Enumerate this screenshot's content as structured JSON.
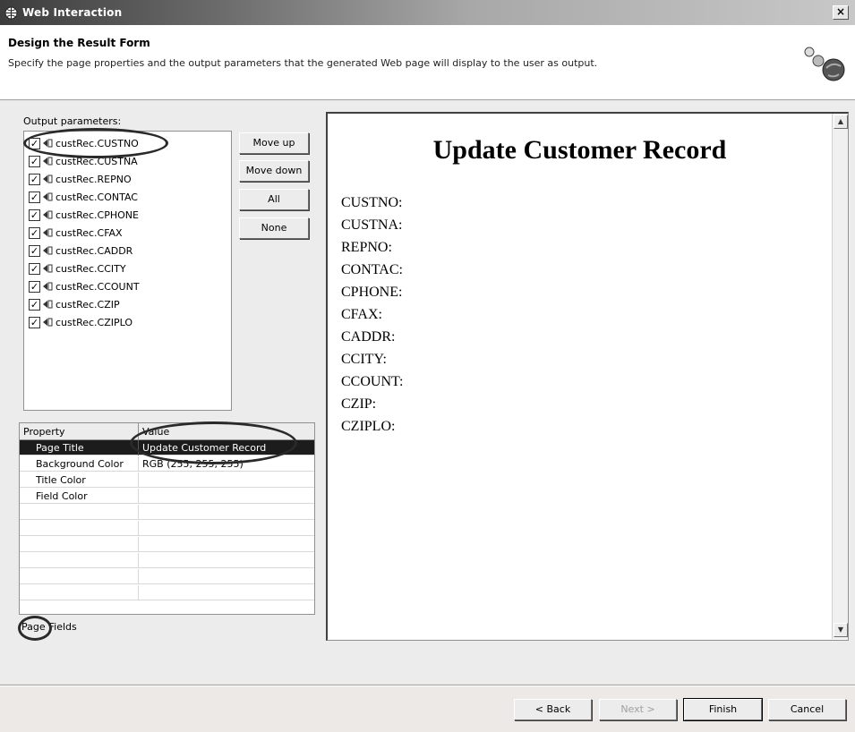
{
  "window": {
    "title": "Web Interaction",
    "close_label": "×",
    "app_icon": "web-interaction-icon"
  },
  "header": {
    "title": "Design the Result Form",
    "description": "Specify the page properties and the output parameters that the generated Web page will display to the user as output.",
    "icon": "wizard-banner-icon"
  },
  "output_parameters": {
    "label": "Output parameters:",
    "items": [
      {
        "label": "custRec.CUSTNO",
        "checked": true
      },
      {
        "label": "custRec.CUSTNA",
        "checked": true
      },
      {
        "label": "custRec.REPNO",
        "checked": true
      },
      {
        "label": "custRec.CONTAC",
        "checked": true
      },
      {
        "label": "custRec.CPHONE",
        "checked": true
      },
      {
        "label": "custRec.CFAX",
        "checked": true
      },
      {
        "label": "custRec.CADDR",
        "checked": true
      },
      {
        "label": "custRec.CCITY",
        "checked": true
      },
      {
        "label": "custRec.CCOUNT",
        "checked": true
      },
      {
        "label": "custRec.CZIP",
        "checked": true
      },
      {
        "label": "custRec.CZIPLO",
        "checked": true
      }
    ],
    "buttons": {
      "move_up": "Move up",
      "move_down": "Move down",
      "all": "All",
      "none": "None"
    }
  },
  "properties": {
    "columns": [
      "Property",
      "Value"
    ],
    "rows": [
      {
        "property": "Page Title",
        "value": "Update Customer Record",
        "selected": true
      },
      {
        "property": "Background Color",
        "value": "RGB (255, 255, 255)",
        "selected": false
      },
      {
        "property": "Title Color",
        "value": "",
        "selected": false
      },
      {
        "property": "Field Color",
        "value": "",
        "selected": false
      }
    ]
  },
  "bottom_tabs": {
    "page": "Page",
    "fields": "Fields"
  },
  "preview": {
    "title": "Update Customer Record",
    "fields": [
      "CUSTNO:",
      "CUSTNA:",
      "REPNO:",
      "CONTAC:",
      "CPHONE:",
      "CFAX:",
      "CADDR:",
      "CCITY:",
      "CCOUNT:",
      "CZIP:",
      "CZIPLO:"
    ]
  },
  "footer": {
    "back": "< Back",
    "next": "Next >",
    "finish": "Finish",
    "cancel": "Cancel"
  }
}
